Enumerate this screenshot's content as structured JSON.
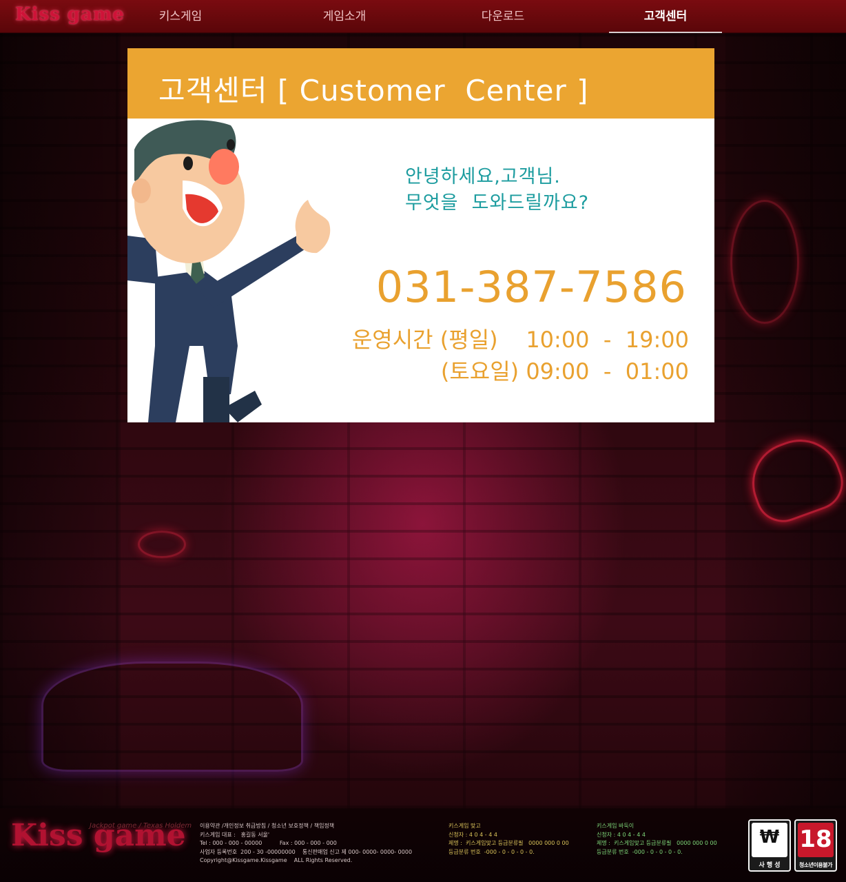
{
  "brand": {
    "logo_text": "Kiss game",
    "logo_subtext": "Jackpot game / Texas Holdem"
  },
  "nav": {
    "items": [
      {
        "label": "키스게임"
      },
      {
        "label": "게임소개"
      },
      {
        "label": "다운로드"
      },
      {
        "label": "고객센터"
      }
    ],
    "active_index": 3
  },
  "panel": {
    "title": "고객센터 [ Customer  Center ]",
    "greeting_line1": "안녕하세요,고객님.",
    "greeting_line2": "무엇을  도와드릴까요?",
    "phone": "031-387-7586",
    "hours_weekday": "운영시간 (평일)    10:00  -  19:00",
    "hours_saturday": "(토요일) 09:00  -  01:00"
  },
  "footer": {
    "col1": [
      "이용약관 /개인정보 취급방침 / 청소년 보호정책 / 책임정책",
      "키스게임 대표 :   홍길동 서울'",
      "Tel : 000 - 000 - 00000          Fax : 000 - 000 - 000",
      "사업자 등록번호  200 - 30 -00000000    통신판매업 신고 제 000- 0000- 0000- 0000",
      "Copyright@Kissgame.Kissgame    ALL Rights Reserved."
    ],
    "col2": [
      "키스게임 맞고",
      "신청자 : 4 0 4 - 4 4",
      "제명 :  키스게임맞고 등급분류필   0000 000 0 00",
      "등급분류 번호  -000 - 0 - 0 - 0 - 0."
    ],
    "col3": [
      "키스게임 바둑이",
      "신청자 : 4 0 4 - 4 4",
      "제명 :  키스게임맞고 등급분류필   0000 000 0 00",
      "등급분류 번호  -000 - 0 - 0 - 0 - 0."
    ],
    "badge_left_label": "사 행 성",
    "badge_left_glyph": "₩",
    "badge_right_label": "청소년이용불가",
    "badge_right_glyph": "18"
  },
  "colors": {
    "header_orange": "#eba531",
    "greeting_teal": "#1c9c9f",
    "phone_orange": "#e9a12f",
    "nav_bar": "#7a0b10"
  }
}
